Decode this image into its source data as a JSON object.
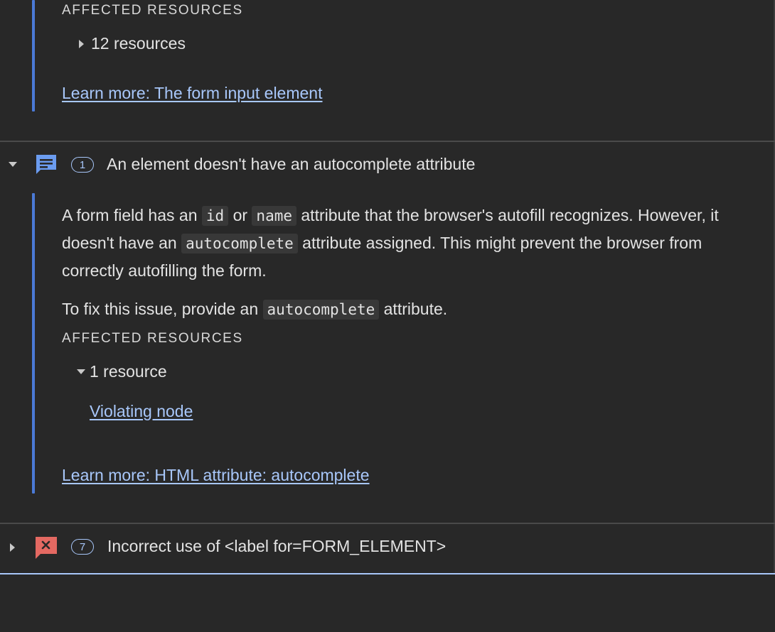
{
  "section1": {
    "affected_heading": "AFFECTED RESOURCES",
    "resources_toggle": "12 resources",
    "learn_more": "Learn more: The form input element"
  },
  "issue_autocomplete": {
    "count": "1",
    "title": "An element doesn't have an autocomplete attribute",
    "desc1": {
      "a": "A form field has an ",
      "code1": "id",
      "b": " or ",
      "code2": "name",
      "c": " attribute that the browser's autofill recognizes. However, it doesn't have an ",
      "code3": "autocomplete",
      "d": " attribute assigned. This might prevent the browser from correctly autofilling the form."
    },
    "desc2": {
      "a": "To fix this issue, provide an ",
      "code1": "autocomplete",
      "b": " attribute."
    },
    "affected_heading": "AFFECTED RESOURCES",
    "resources_toggle": "1 resource",
    "violating_node": "Violating node",
    "learn_more": "Learn more: HTML attribute: autocomplete"
  },
  "issue_label": {
    "count": "7",
    "title": "Incorrect use of <label for=FORM_ELEMENT>"
  },
  "icons": {
    "info": "message-icon",
    "error": "error-x-icon"
  },
  "colors": {
    "background": "#282828",
    "accent_bar": "#4b7ad7",
    "link": "#a8c7fa",
    "info_icon": "#6b9cf0",
    "error_icon": "#e46962",
    "divider": "#4a4a4a",
    "selected_divider": "#a8c7fa"
  }
}
